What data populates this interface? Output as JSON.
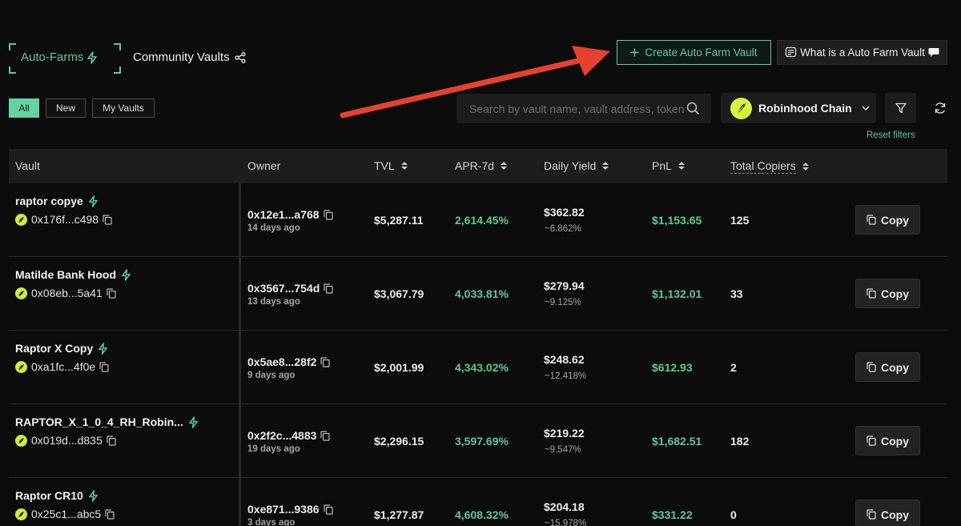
{
  "header": {
    "tab_autofarms": "Auto-Farms",
    "tab_community": "Community Vaults",
    "create_button": "Create Auto Farm Vault",
    "what_button": "What is a Auto Farm Vault"
  },
  "filters": {
    "chips": [
      "All",
      "New",
      "My Vaults"
    ],
    "active_chip": "All",
    "search_placeholder": "Search by vault name, vault address, token",
    "chain": "Robinhood Chain",
    "reset": "Reset filters"
  },
  "table": {
    "columns": {
      "vault": "Vault",
      "owner": "Owner",
      "tvl": "TVL",
      "apr": "APR-7d",
      "yield": "Daily Yield",
      "pnl": "PnL",
      "copiers": "Total Copiers"
    },
    "copy_label": "Copy",
    "rows": [
      {
        "name": "raptor copye",
        "address": "0x176f...c498",
        "owner": "0x12e1...a768",
        "owner_age": "14 days ago",
        "tvl": "$5,287.11",
        "apr": "2,614.45%",
        "yield": "$362.82",
        "yield_pct": "~6.862%",
        "pnl": "$1,153.65",
        "copiers": "125"
      },
      {
        "name": "Matilde Bank Hood",
        "address": "0x08eb...5a41",
        "owner": "0x3567...754d",
        "owner_age": "13 days ago",
        "tvl": "$3,067.79",
        "apr": "4,033.81%",
        "yield": "$279.94",
        "yield_pct": "~9.125%",
        "pnl": "$1,132.01",
        "copiers": "33"
      },
      {
        "name": "Raptor X Copy",
        "address": "0xa1fc...4f0e",
        "owner": "0x5ae8...28f2",
        "owner_age": "9 days ago",
        "tvl": "$2,001.99",
        "apr": "4,343.02%",
        "yield": "$248.62",
        "yield_pct": "~12.418%",
        "pnl": "$612.93",
        "copiers": "2"
      },
      {
        "name": "RAPTOR_X_1_0_4_RH_Robin...",
        "address": "0x019d...d835",
        "owner": "0x2f2c...4883",
        "owner_age": "19 days ago",
        "tvl": "$2,296.15",
        "apr": "3,597.69%",
        "yield": "$219.22",
        "yield_pct": "~9.547%",
        "pnl": "$1,682.51",
        "copiers": "182"
      },
      {
        "name": "Raptor CR10",
        "address": "0x25c1...abc5",
        "owner": "0xe871...9386",
        "owner_age": "3 days ago",
        "tvl": "$1,277.87",
        "apr": "4,608.32%",
        "yield": "$204.18",
        "yield_pct": "~15.978%",
        "pnl": "$331.22",
        "copiers": "0"
      }
    ]
  },
  "colors": {
    "accent": "#5ec9a0",
    "positive": "#5fc79d",
    "annotation_arrow": "#e5412d",
    "chain_logo": "#d4f53d"
  },
  "icons": [
    "bolt-icon",
    "share-icon",
    "plus-icon",
    "doc-icon",
    "chat-bubble-icon",
    "search-icon",
    "chevron-down-icon",
    "filter-icon",
    "refresh-icon",
    "leaf-icon",
    "copy-icon",
    "sort-icon"
  ]
}
